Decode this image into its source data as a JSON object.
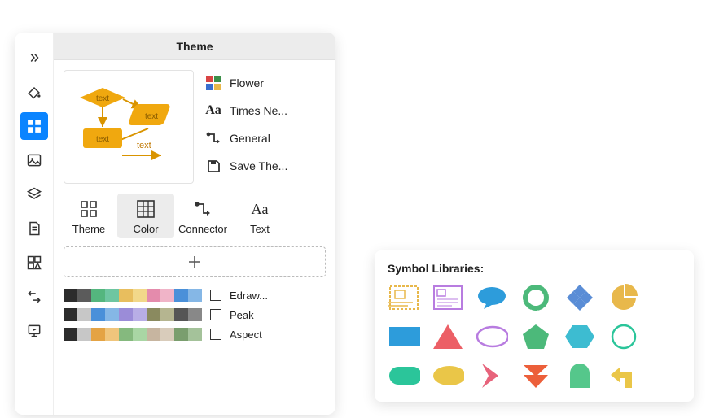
{
  "panel": {
    "title": "Theme",
    "toolbar_icons": [
      "expand-icon",
      "fill-icon",
      "grid-icon",
      "image-icon",
      "layers-icon",
      "document-icon",
      "shapes-icon",
      "arrange-icon",
      "presentation-icon"
    ],
    "theme_options": [
      {
        "label": "Flower",
        "icon": "color-grid-icon"
      },
      {
        "label": "Times Ne...",
        "icon": "font-icon"
      },
      {
        "label": "General",
        "icon": "connector-icon"
      },
      {
        "label": "Save The...",
        "icon": "save-icon"
      }
    ],
    "preview_texts": [
      "text",
      "text",
      "text",
      "text"
    ],
    "sub_tabs": [
      {
        "label": "Theme",
        "icon": "four-squares-icon"
      },
      {
        "label": "Color",
        "icon": "grid-fill-icon"
      },
      {
        "label": "Connector",
        "icon": "connector-icon"
      },
      {
        "label": "Text",
        "icon": "font-icon"
      }
    ],
    "selected_sub_tab": 1,
    "palettes": [
      {
        "name": "Edraw...",
        "colors": [
          "#2c2c2c",
          "#5b5b5b",
          "#54b67e",
          "#6ec6a1",
          "#e8be5e",
          "#f2d88a",
          "#e48bac",
          "#f0b4c8",
          "#4a90d9",
          "#85b7e6"
        ]
      },
      {
        "name": "Peak",
        "colors": [
          "#2c2c2c",
          "#c7c7c7",
          "#4a90d9",
          "#85b7e6",
          "#9b8cd8",
          "#b8aee6",
          "#8a8a5f",
          "#b5b590",
          "#555555",
          "#888888"
        ]
      },
      {
        "name": "Aspect",
        "colors": [
          "#2c2c2c",
          "#c7c7c7",
          "#e4a344",
          "#f0c57c",
          "#85b97e",
          "#a9d6a4",
          "#c7b5a0",
          "#d9ccbb",
          "#7a9e6e",
          "#a4c29a"
        ]
      }
    ]
  },
  "symbol_libraries": {
    "title": "Symbol Libraries:"
  }
}
